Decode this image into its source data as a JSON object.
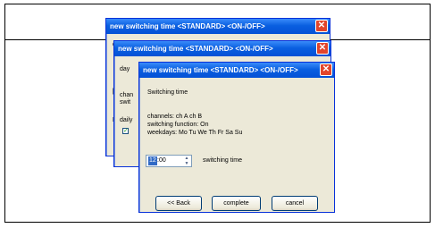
{
  "window_title": "new switching time <STANDARD> <ON-/OFF>",
  "back_windows": {
    "w2_fragments": [
      "day",
      "chan",
      "swit",
      "daily"
    ],
    "w1_fragments": [
      "C",
      "[",
      "B"
    ]
  },
  "dialog": {
    "heading": "Switching time",
    "channels": "channels: ch A ch B",
    "function": "switching function: On",
    "weekdays": "weekdays: Mo Tu We Th Fr Sa Su",
    "time_hour": "12",
    "time_rest": ":00",
    "time_label": "switching time",
    "back_button": "<< Back",
    "complete_button": "complete",
    "cancel_button": "cancel"
  }
}
